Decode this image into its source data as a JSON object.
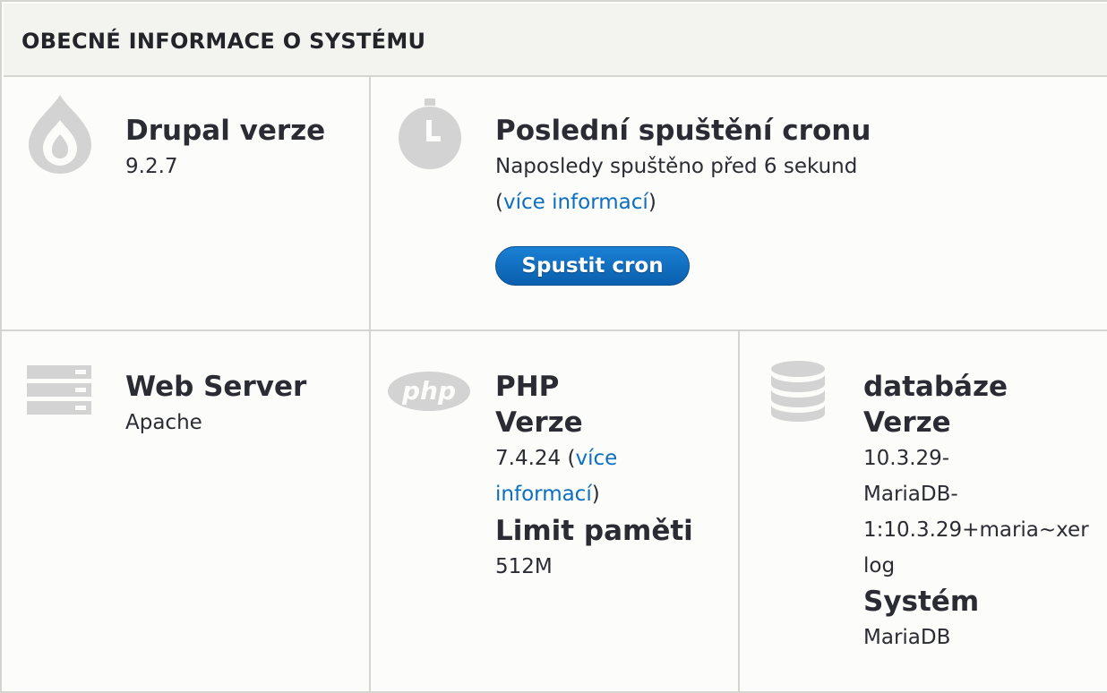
{
  "header": {
    "title": "OBECNÉ INFORMACE O SYSTÉMU"
  },
  "drupal": {
    "title": "Drupal verze",
    "version": "9.2.7",
    "icon": "drupal-drop-icon"
  },
  "cron": {
    "title": "Poslední spuštění cronu",
    "last_run": "Naposledy spuštěno před 6 sekund",
    "paren_open": "(",
    "more_info": "více informací",
    "paren_close": ")",
    "button_label": "Spustit cron",
    "icon": "clock-icon"
  },
  "webserver": {
    "title": "Web Server",
    "value": "Apache",
    "icon": "server-icon"
  },
  "php": {
    "title": "PHP",
    "version_label": "Verze",
    "version_value": "7.4.24 (",
    "more_info_1": "více",
    "more_info_2": "informací",
    "paren_close": ")",
    "memory_label": "Limit paměti",
    "memory_value": "512M",
    "icon": "php-logo-icon"
  },
  "database": {
    "title": "databáze",
    "version_label": "Verze",
    "version_lines": [
      "10.3.29-",
      "MariaDB-",
      "1:10.3.29+maria~xer",
      "log"
    ],
    "system_label": "Systém",
    "system_value": "MariaDB",
    "icon": "database-icon"
  },
  "colors": {
    "link": "#0c6ec1",
    "button": "#0a64b4",
    "icon_gray": "#d3d3d3"
  }
}
